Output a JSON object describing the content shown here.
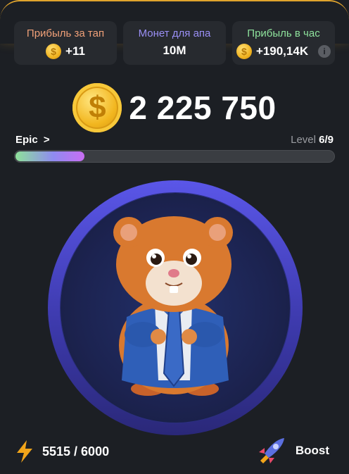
{
  "stats": [
    {
      "title": "Прибыль за тап",
      "value": "+11",
      "title_color": "#f0a078",
      "icon": "coin-icon"
    },
    {
      "title": "Монет для апа",
      "value": "10M",
      "title_color": "#9a8ff5"
    },
    {
      "title": "Прибыль в час",
      "value": "+190,14K",
      "title_color": "#8fe39d",
      "icon": "coin-icon",
      "info_icon": "info-icon"
    }
  ],
  "balance": {
    "value": "2 225 750",
    "icon": "dollar-coin-icon"
  },
  "league": {
    "name": "Epic",
    "chevron": ">"
  },
  "level": {
    "label": "Level",
    "current": "6/9"
  },
  "progress": {
    "fraction": 0.22
  },
  "energy": {
    "value": "5515 / 6000",
    "icon": "lightning-icon"
  },
  "boost": {
    "label": "Boost",
    "icon": "rocket-icon"
  },
  "colors": {
    "accent_gold": "#e0a42d",
    "background": "#1c1f24",
    "card": "#272a2f",
    "orb": "#4a46d0"
  }
}
